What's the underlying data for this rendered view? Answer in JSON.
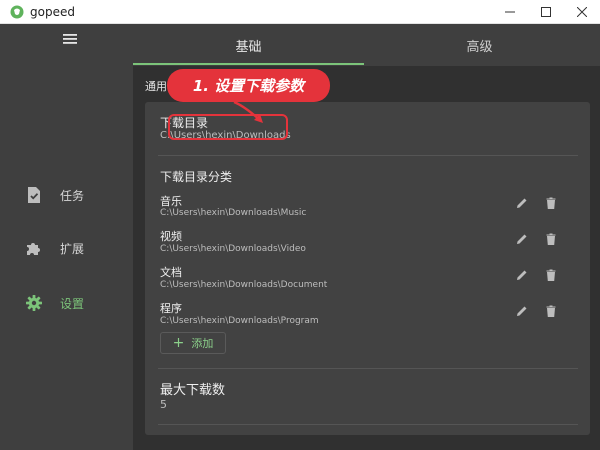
{
  "window": {
    "title": "gopeed",
    "accent": "#7cc47a"
  },
  "sidebar": {
    "menu_icon": "hamburger-icon",
    "items": [
      {
        "label": "任务",
        "icon": "task-icon"
      },
      {
        "label": "扩展",
        "icon": "puzzle-icon"
      },
      {
        "label": "设置",
        "icon": "gear-icon",
        "active": true
      }
    ]
  },
  "tabs": [
    {
      "label": "基础",
      "active": true
    },
    {
      "label": "高级",
      "active": false
    }
  ],
  "section": {
    "label": "通用"
  },
  "download_dir": {
    "title": "下载目录",
    "value": "C:\\Users\\hexin\\Downloads"
  },
  "categories": {
    "title": "下载目录分类",
    "items": [
      {
        "name": "音乐",
        "path": "C:\\Users\\hexin\\Downloads\\Music"
      },
      {
        "name": "视频",
        "path": "C:\\Users\\hexin\\Downloads\\Video"
      },
      {
        "name": "文档",
        "path": "C:\\Users\\hexin\\Downloads\\Document"
      },
      {
        "name": "程序",
        "path": "C:\\Users\\hexin\\Downloads\\Program"
      }
    ],
    "add_label": "添加"
  },
  "max_downloads": {
    "title": "最大下载数",
    "value": "5"
  },
  "annotation": {
    "text": "1. 设置下载参数",
    "color": "#e4333b"
  }
}
